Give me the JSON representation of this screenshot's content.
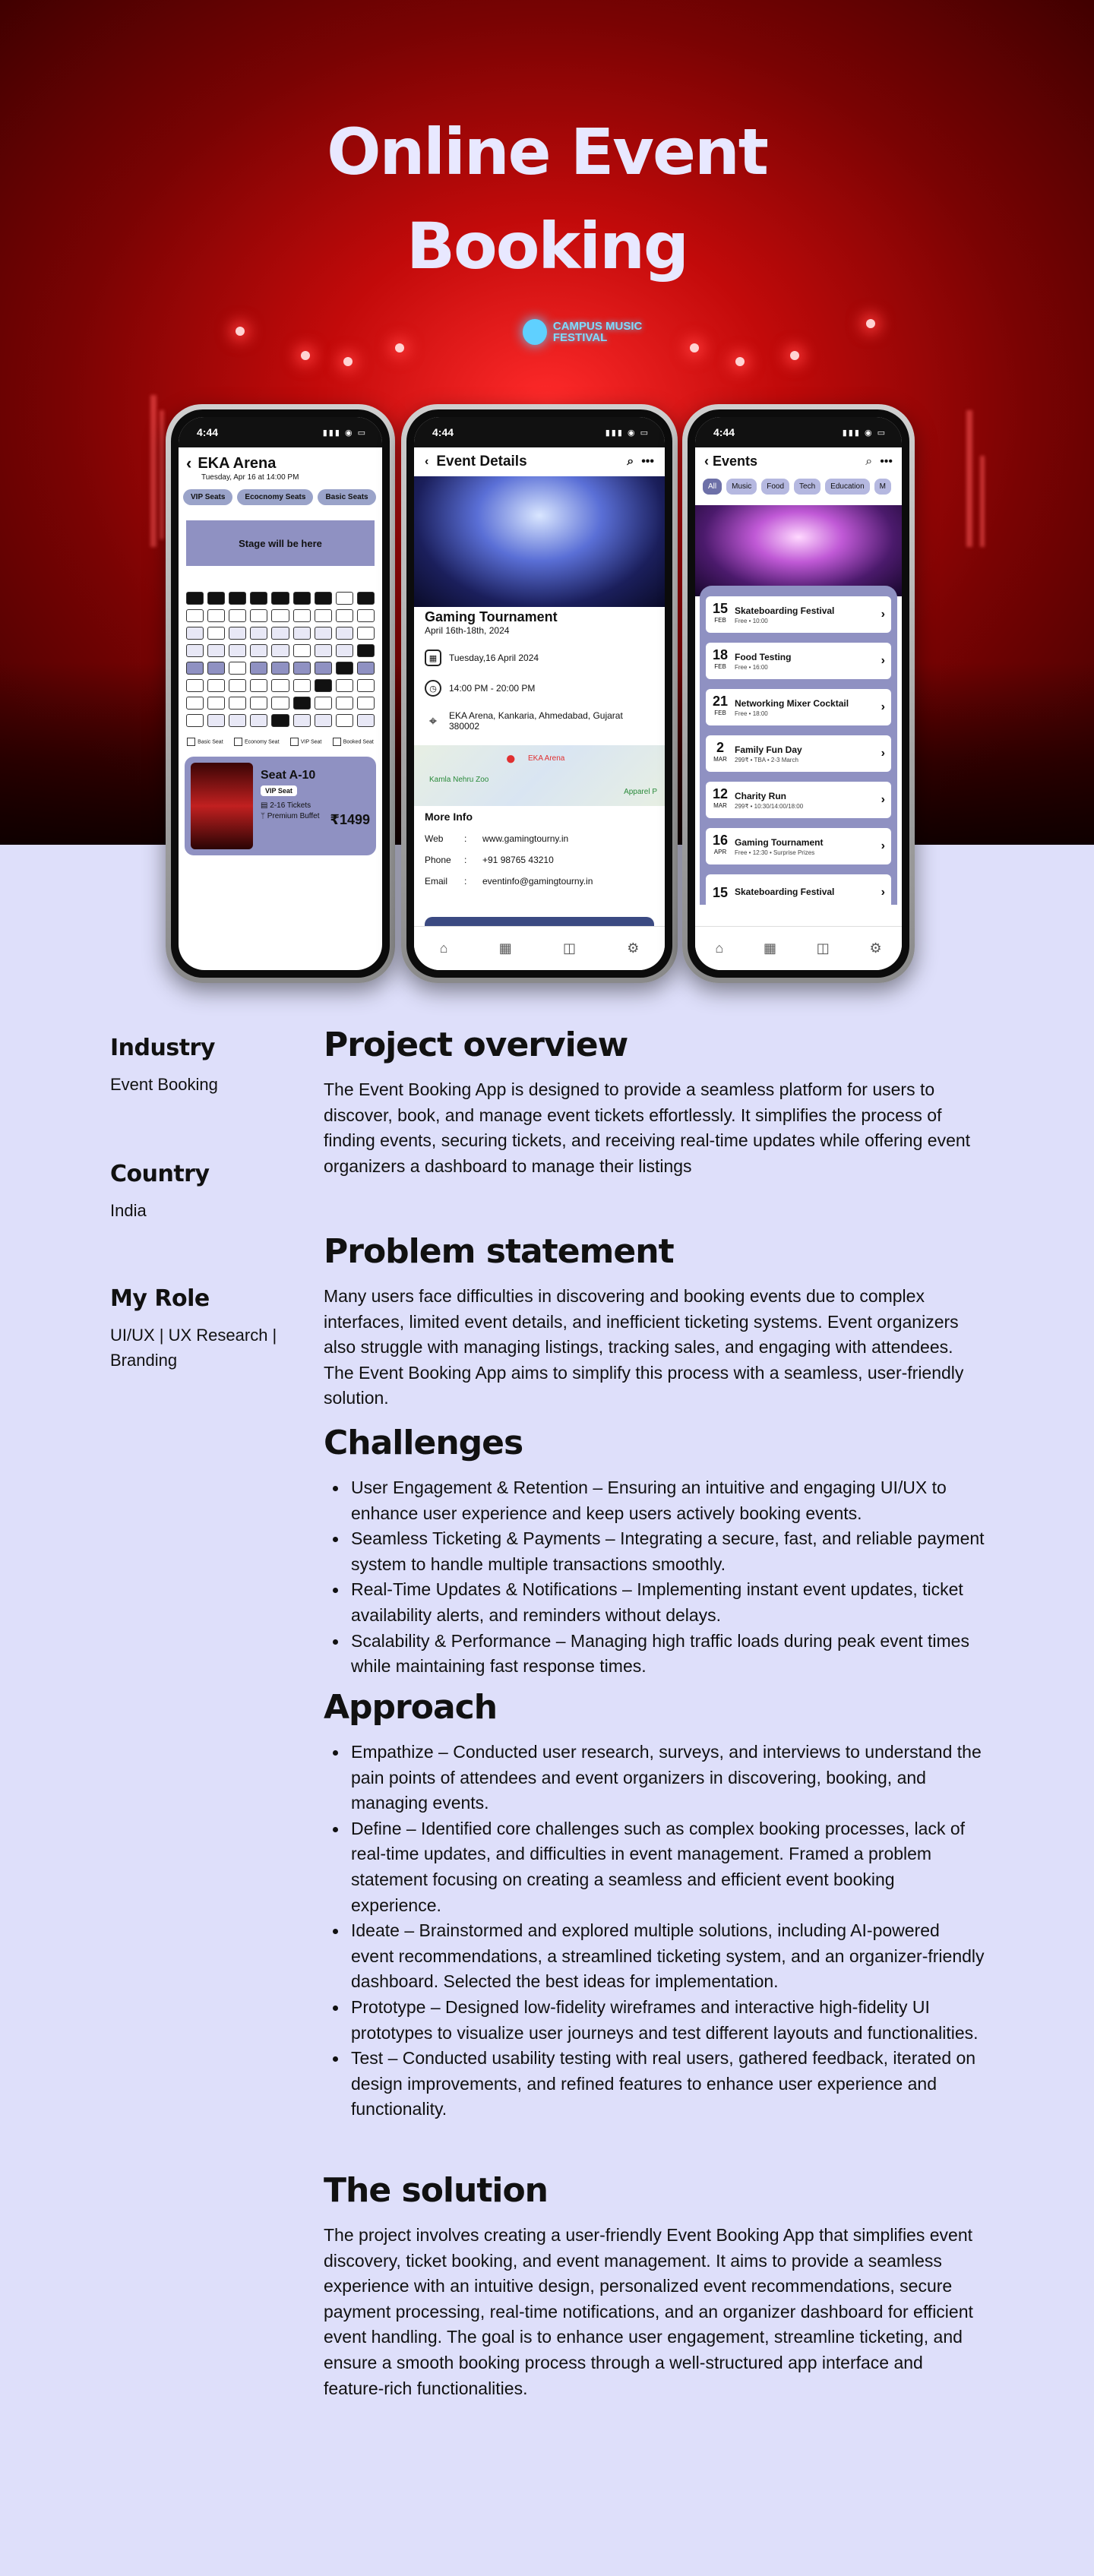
{
  "hero": {
    "title_line1": "Online Event",
    "title_line2": "Booking",
    "festival_sign": "CAMPUS MUSIC FESTIVAL"
  },
  "phone_seats": {
    "time": "4:44",
    "venue": "EKA Arena",
    "date": "Tuesday, Apr 16 at 14:00 PM",
    "tabs": [
      "VIP Seats",
      "Ecocnomy Seats",
      "Basic Seats"
    ],
    "stage": "Stage will be here",
    "legend": [
      "Basic Seat",
      "Economy Seat",
      "VIP Seat",
      "Booked Seat"
    ],
    "ticket": {
      "seat": "Seat A-10",
      "class": "VIP Seat",
      "tickets": "2-16 Tickets",
      "food": "Premium Buffet",
      "price": "₹1499"
    }
  },
  "phone_details": {
    "time": "4:44",
    "title": "Event Details",
    "event_name": "Gaming Tournament",
    "event_dates": "April 16th-18th, 2024",
    "date": "Tuesday,16 April 2024",
    "time_range": "14:00 PM - 20:00 PM",
    "address": "EKA Arena, Kankaria, Ahmedabad, Gujarat 380002",
    "map_labels": [
      "EKA Arena",
      "Kamla Nehru Zoo",
      "Apparel P"
    ],
    "more_info": "More Info",
    "web_label": "Web",
    "web": "www.gamingtourny.in",
    "phone_label": "Phone",
    "phone": "+91 98765 43210",
    "email_label": "Email",
    "email": "eventinfo@gamingtourny.in"
  },
  "phone_events": {
    "time": "4:44",
    "title": "Events",
    "chips": [
      "All",
      "Music",
      "Food",
      "Tech",
      "Education",
      "M"
    ],
    "events": [
      {
        "day": "15",
        "month": "FEB",
        "name": "Skateboarding Festival",
        "sub": "Free • 10:00"
      },
      {
        "day": "18",
        "month": "FEB",
        "name": "Food Testing",
        "sub": "Free • 16:00"
      },
      {
        "day": "21",
        "month": "FEB",
        "name": "Networking Mixer Cocktail",
        "sub": "Free • 18:00"
      },
      {
        "day": "2",
        "month": "MAR",
        "name": "Family Fun Day",
        "sub": "299₹ • TBA • 2-3 March"
      },
      {
        "day": "12",
        "month": "MAR",
        "name": "Charity Run",
        "sub": "299₹ • 10:30/14:00/18:00"
      },
      {
        "day": "16",
        "month": "APR",
        "name": "Gaming Tournament",
        "sub": "Free • 12:30 • Surprise Prizes"
      },
      {
        "day": "15",
        "month": "",
        "name": "Skateboarding Festival",
        "sub": ""
      }
    ]
  },
  "sidebar": {
    "industry_label": "Industry",
    "industry": "Event Booking",
    "country_label": "Country",
    "country": "India",
    "role_label": "My Role",
    "role": "UI/UX | UX Research | Branding"
  },
  "overview": {
    "title": "Project overview",
    "text": "The Event Booking App is designed to provide a seamless platform for users to discover, book, and manage event tickets effortlessly. It simplifies the process of finding events, securing tickets, and receiving real-time updates while offering event organizers a dashboard to manage their listings"
  },
  "problem": {
    "title": "Problem statement",
    "text": "Many users face difficulties in discovering and booking events due to complex interfaces, limited event details, and inefficient ticketing systems. Event organizers also struggle with managing listings, tracking sales, and engaging with attendees. The Event Booking App aims to simplify this process with a seamless, user-friendly solution."
  },
  "challenges": {
    "title": "Challenges",
    "items": [
      "User Engagement & Retention – Ensuring an intuitive and engaging UI/UX to enhance user experience and keep users actively booking events.",
      "Seamless Ticketing & Payments – Integrating a secure, fast, and reliable payment system to handle multiple transactions smoothly.",
      "Real-Time Updates & Notifications – Implementing instant event updates, ticket availability alerts, and reminders without delays.",
      "Scalability & Performance – Managing high traffic loads during peak event times while maintaining fast response times."
    ]
  },
  "approach": {
    "title": "Approach",
    "items": [
      "Empathize – Conducted user research, surveys, and interviews to understand the pain points of attendees and event organizers in discovering, booking, and managing events.",
      "Define – Identified core challenges such as complex booking processes, lack of real-time updates, and difficulties in event management. Framed a problem statement focusing on creating a seamless and efficient event booking experience.",
      "Ideate – Brainstormed and explored multiple solutions, including AI-powered event recommendations, a streamlined ticketing system, and an organizer-friendly dashboard. Selected the best ideas for implementation.",
      "Prototype – Designed low-fidelity wireframes and interactive high-fidelity UI prototypes to visualize user journeys and test different layouts and functionalities.",
      "Test – Conducted usability testing with real users, gathered feedback, iterated on design improvements, and refined features to enhance user experience and functionality."
    ]
  },
  "solution": {
    "title": "The solution",
    "text": "The project involves creating a user-friendly Event Booking App that simplifies event discovery, ticket booking, and event management. It aims to provide a seamless experience with an intuitive design, personalized event recommendations, secure payment processing, real-time notifications, and an organizer dashboard for efficient event handling. The goal is to enhance user engagement, streamline ticketing, and ensure a smooth booking process through a well-structured app interface and feature-rich functionalities."
  },
  "colors": {
    "page_bg": "#dedffa",
    "accent": "#8f91c2",
    "hero_red": "#c20a0a"
  }
}
